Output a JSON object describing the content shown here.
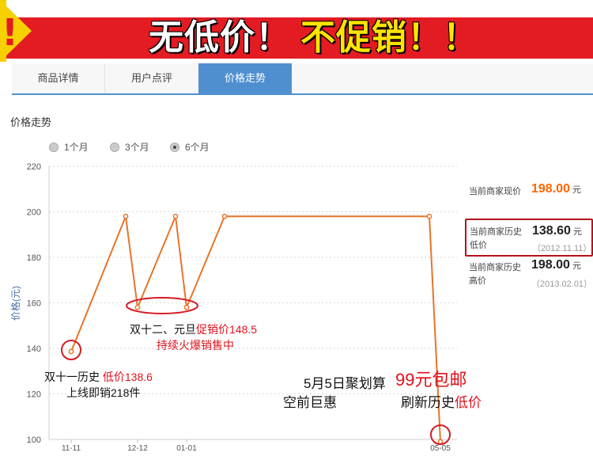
{
  "banner": {
    "bang": "!",
    "text1": "无低价！",
    "text2": "不促销！！"
  },
  "tabs": [
    {
      "label": "商品详情",
      "active": false
    },
    {
      "label": "用户点评",
      "active": false
    },
    {
      "label": "价格走势",
      "active": true
    }
  ],
  "section_title": "价格走势",
  "range_options": [
    {
      "label": "1个月",
      "selected": false
    },
    {
      "label": "3个月",
      "selected": false
    },
    {
      "label": "6个月",
      "selected": true
    }
  ],
  "chart_data": {
    "type": "line",
    "ylabel": "价格(元)",
    "xlabel": "",
    "ylim": [
      100,
      220
    ],
    "yticks": [
      100,
      120,
      140,
      160,
      180,
      200,
      220
    ],
    "x_tick_labels": [
      "11-11",
      "12-12",
      "01-01",
      "05-05"
    ],
    "grid": true,
    "line_color": "#e8742a",
    "series": [
      {
        "points": [
          {
            "x": "11-11",
            "y": 138.6
          },
          {
            "x": "11-24",
            "y": 198
          },
          {
            "x": "12-12",
            "y": 158
          },
          {
            "x": "12-28",
            "y": 198
          },
          {
            "x": "01-01",
            "y": 158
          },
          {
            "x": "01-15",
            "y": 198
          },
          {
            "x": "05-01",
            "y": 198
          },
          {
            "x": "05-05",
            "y": 99
          }
        ]
      }
    ]
  },
  "price_panel": {
    "current": {
      "label": "当前商家现价",
      "value": "198.00",
      "unit": "元"
    },
    "lowest": {
      "label": "当前商家历史低价",
      "value": "138.60",
      "unit": "元",
      "date": "（2012.11.11）"
    },
    "highest": {
      "label": "当前商家历史高价",
      "value": "198.00",
      "unit": "元",
      "date": "（2013.02.01）"
    }
  },
  "annotations": {
    "a1_black": "双十一历史",
    "a1_red": "低价138.6",
    "a2": "上线即销218件",
    "b1_black": "双十二、元旦",
    "b1_red": "促销价148.5",
    "b2": "持续火爆销售中",
    "c1": "5月5日聚划算",
    "c1_red": "99元包邮",
    "c2": "空前巨惠",
    "c3_black": "刷新历史",
    "c3_red": "低价"
  }
}
